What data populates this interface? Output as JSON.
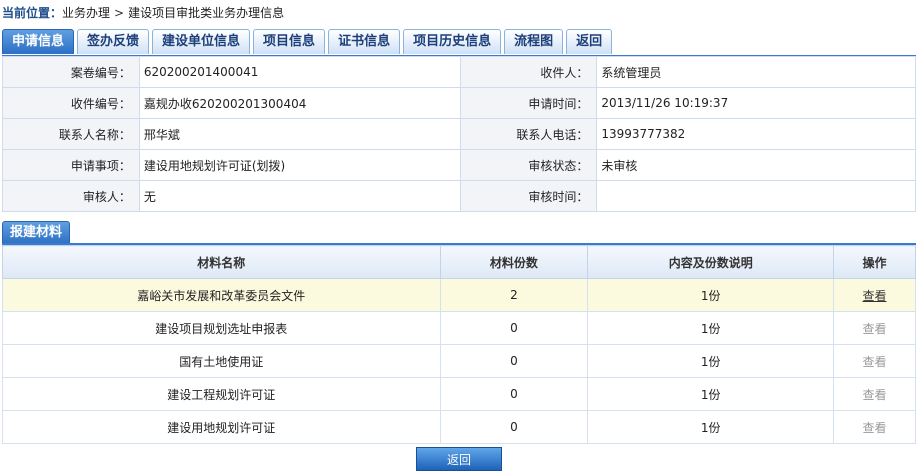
{
  "breadcrumb": {
    "lead": "当前位置：",
    "items": [
      "业务办理",
      "建设项目审批类业务办理信息"
    ],
    "sep": ">"
  },
  "tabs": [
    "申请信息",
    "签办反馈",
    "建设单位信息",
    "项目信息",
    "证书信息",
    "项目历史信息",
    "流程图",
    "返回"
  ],
  "info": {
    "case_no_label": "案卷编号：",
    "case_no": "620200201400041",
    "receiver_label": "收件人：",
    "receiver": "系统管理员",
    "receipt_no_label": "收件编号：",
    "receipt_no": "嘉规办收620200201300404",
    "apply_time_label": "申请时间：",
    "apply_time": "2013/11/26 10:19:37",
    "contact_label": "联系人名称：",
    "contact": "邢华斌",
    "phone_label": "联系人电话：",
    "phone": "13993777382",
    "item_label": "申请事项：",
    "item": "建设用地规划许可证(划拨)",
    "status_label": "审核状态：",
    "status": "未审核",
    "reviewer_label": "审核人：",
    "reviewer": "无",
    "review_time_label": "审核时间：",
    "review_time": ""
  },
  "materials": {
    "section_title": "报建材料",
    "headers": [
      "材料名称",
      "材料份数",
      "内容及份数说明",
      "操作"
    ],
    "rows": [
      {
        "name": "嘉峪关市发展和改革委员会文件",
        "count": "2",
        "desc": "1份",
        "action": "查看"
      },
      {
        "name": "建设项目规划选址申报表",
        "count": "0",
        "desc": "1份",
        "action": "查看"
      },
      {
        "name": "国有土地使用证",
        "count": "0",
        "desc": "1份",
        "action": "查看"
      },
      {
        "name": "建设工程规划许可证",
        "count": "0",
        "desc": "1份",
        "action": "查看"
      },
      {
        "name": "建设用地规划许可证",
        "count": "0",
        "desc": "1份",
        "action": "查看"
      }
    ]
  },
  "back_button": "返回"
}
